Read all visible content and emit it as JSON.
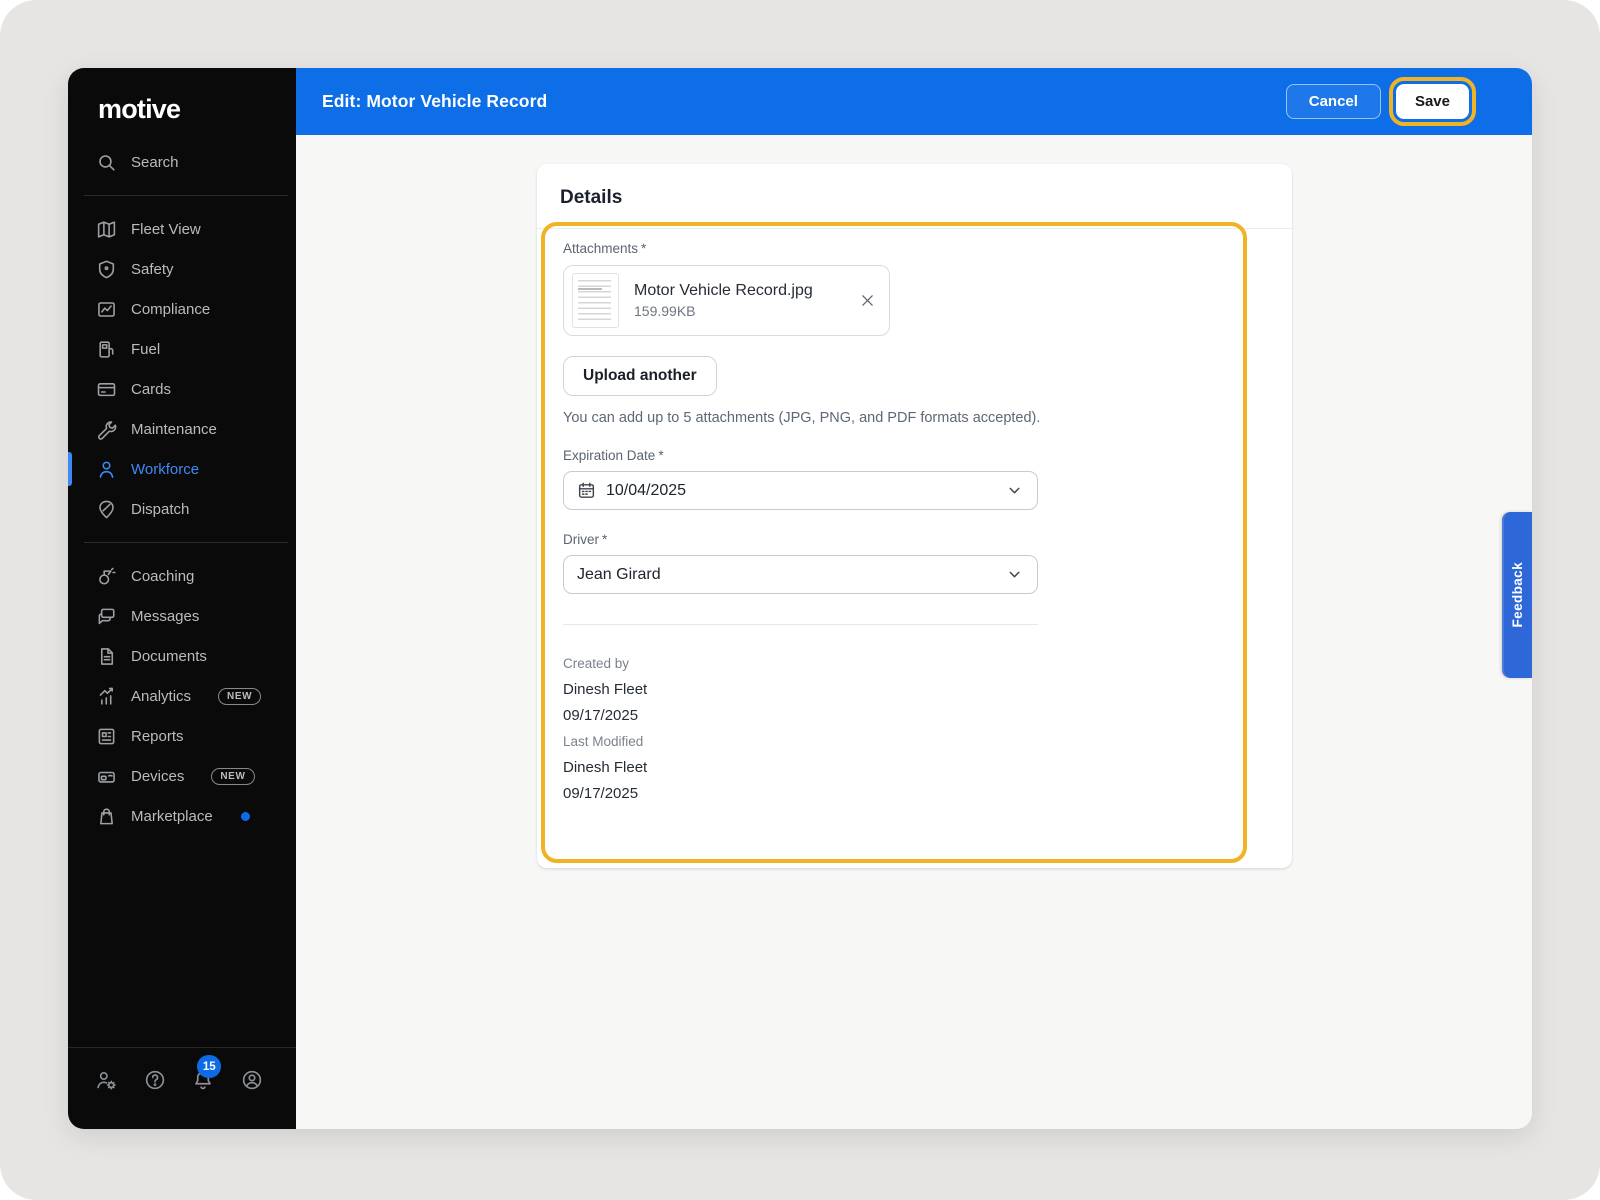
{
  "brand": {
    "logo_text": "motive"
  },
  "sidebar": {
    "search_label": "Search",
    "primary": [
      {
        "label": "Fleet View"
      },
      {
        "label": "Safety"
      },
      {
        "label": "Compliance"
      },
      {
        "label": "Fuel"
      },
      {
        "label": "Cards"
      },
      {
        "label": "Maintenance"
      },
      {
        "label": "Workforce",
        "active": true
      },
      {
        "label": "Dispatch"
      }
    ],
    "secondary": [
      {
        "label": "Coaching"
      },
      {
        "label": "Messages"
      },
      {
        "label": "Documents"
      },
      {
        "label": "Analytics",
        "badge": "NEW"
      },
      {
        "label": "Reports"
      },
      {
        "label": "Devices",
        "badge": "NEW"
      },
      {
        "label": "Marketplace",
        "dot": true
      }
    ],
    "notification_count": "15"
  },
  "header": {
    "title": "Edit: Motor Vehicle Record",
    "cancel_label": "Cancel",
    "save_label": "Save"
  },
  "details": {
    "title": "Details",
    "attachments_label": "Attachments",
    "required_marker": "*",
    "file": {
      "name": "Motor Vehicle Record.jpg",
      "size": "159.99KB"
    },
    "upload_button_label": "Upload another",
    "helper_text": "You can add up to 5 attachments (JPG, PNG, and PDF formats accepted).",
    "expiration_label": "Expiration Date",
    "expiration_value": "10/04/2025",
    "driver_label": "Driver",
    "driver_value": "Jean Girard",
    "created_by_label": "Created by",
    "created_by_name": "Dinesh Fleet",
    "created_by_date": "09/17/2025",
    "last_modified_label": "Last Modified",
    "last_modified_name": "Dinesh Fleet",
    "last_modified_date": "09/17/2025"
  },
  "feedback_tab_label": "Feedback",
  "colors": {
    "header_blue": "#0d6ee8",
    "sidebar_black": "#0a0a0b",
    "active_blue": "#3d8af7",
    "badge_blue": "#0e6be8",
    "highlight_gold": "#f0b323",
    "feedback_blue": "#2e67d8",
    "content_bg": "#f7f7f6"
  }
}
